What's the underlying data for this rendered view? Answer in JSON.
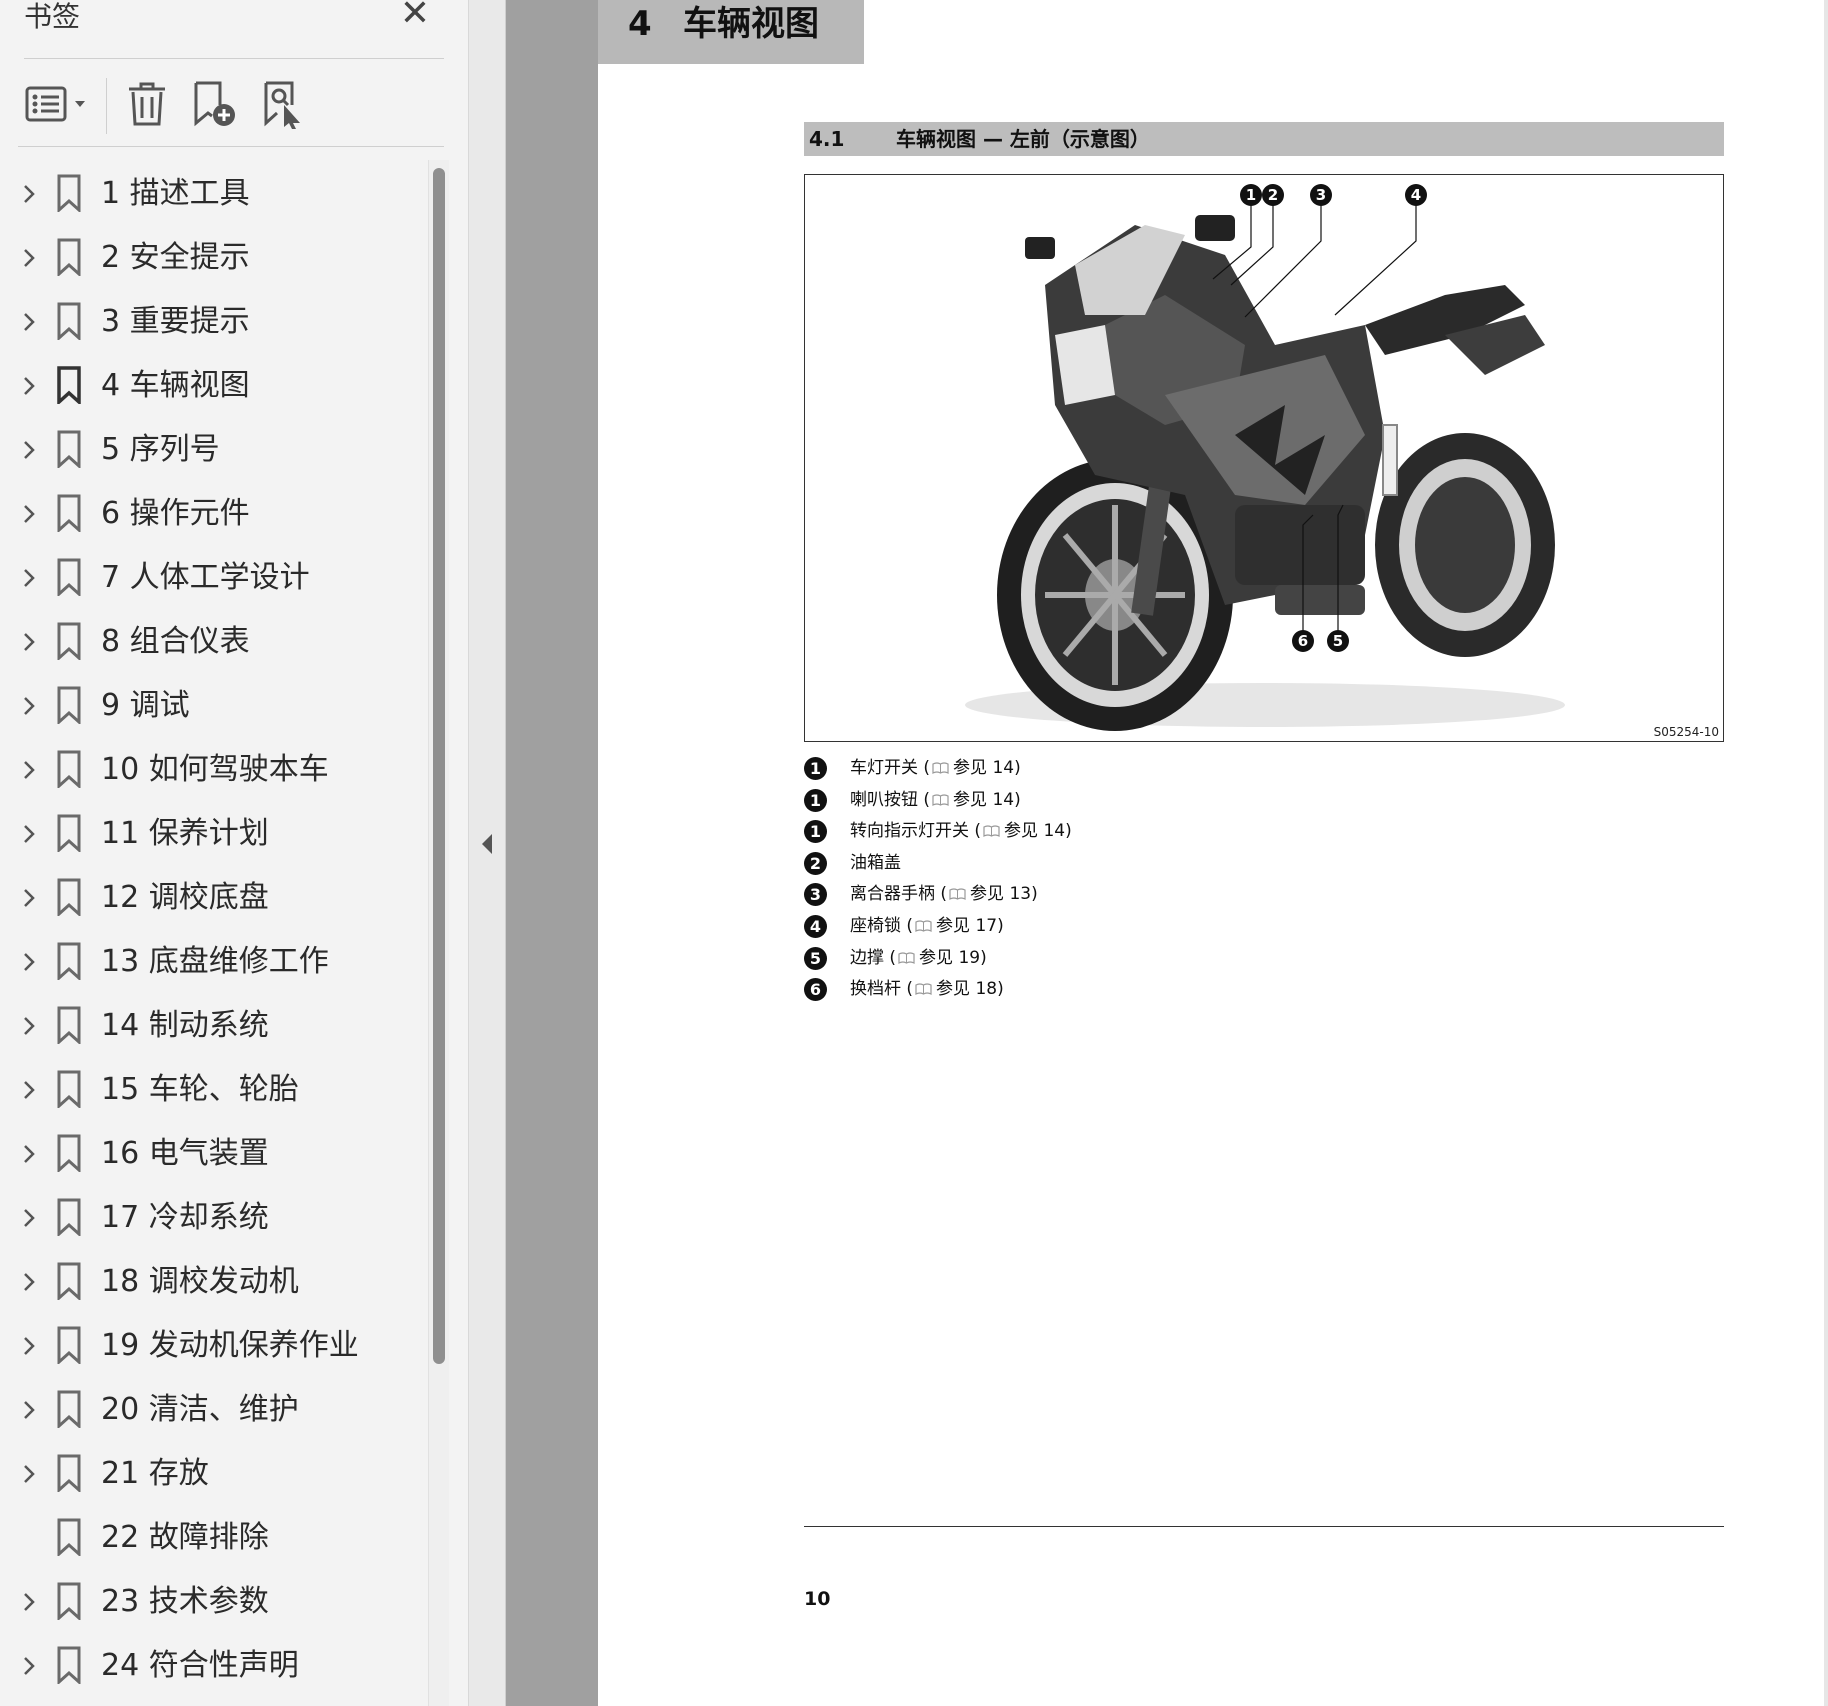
{
  "sidebar": {
    "title": "书签",
    "close_icon": "close-icon",
    "toolbar": {
      "options_icon": "list-options-icon",
      "delete_icon": "trash-icon",
      "add_icon": "add-bookmark-icon",
      "find_icon": "find-bookmark-icon"
    },
    "bookmarks": [
      {
        "label": "1 描述工具",
        "expandable": true
      },
      {
        "label": "2 安全提示",
        "expandable": true
      },
      {
        "label": "3 重要提示",
        "expandable": true
      },
      {
        "label": "4 车辆视图",
        "expandable": true,
        "current": true
      },
      {
        "label": "5 序列号",
        "expandable": true
      },
      {
        "label": "6 操作元件",
        "expandable": true
      },
      {
        "label": "7 人体工学设计",
        "expandable": true
      },
      {
        "label": "8 组合仪表",
        "expandable": true
      },
      {
        "label": "9 调试",
        "expandable": true
      },
      {
        "label": "10 如何驾驶本车",
        "expandable": true
      },
      {
        "label": "11 保养计划",
        "expandable": true
      },
      {
        "label": "12 调校底盘",
        "expandable": true
      },
      {
        "label": "13 底盘维修工作",
        "expandable": true
      },
      {
        "label": "14 制动系统",
        "expandable": true
      },
      {
        "label": "15 车轮、轮胎",
        "expandable": true
      },
      {
        "label": "16 电气装置",
        "expandable": true
      },
      {
        "label": "17 冷却系统",
        "expandable": true
      },
      {
        "label": "18 调校发动机",
        "expandable": true
      },
      {
        "label": "19 发动机保养作业",
        "expandable": true
      },
      {
        "label": "20 清洁、维护",
        "expandable": true
      },
      {
        "label": "21 存放",
        "expandable": true
      },
      {
        "label": "22 故障排除",
        "expandable": false
      },
      {
        "label": "23 技术参数",
        "expandable": true
      },
      {
        "label": "24 符合性声明",
        "expandable": true
      }
    ]
  },
  "page": {
    "chapter_number": "4",
    "chapter_title": "车辆视图",
    "section_number": "4.1",
    "section_title": "车辆视图 — 左前（示意图）",
    "figure_code": "S05254-10",
    "figure_callouts": [
      "1",
      "2",
      "3",
      "4",
      "5",
      "6"
    ],
    "legend": [
      {
        "num": "1",
        "text": "车灯开关 (",
        "ref": "参见 14)"
      },
      {
        "num": "1",
        "text": "喇叭按钮 (",
        "ref": "参见 14)"
      },
      {
        "num": "1",
        "text": "转向指示灯开关 (",
        "ref": "参见 14)"
      },
      {
        "num": "2",
        "text": "油箱盖",
        "ref": ""
      },
      {
        "num": "3",
        "text": "离合器手柄 (",
        "ref": "参见 13)"
      },
      {
        "num": "4",
        "text": "座椅锁 (",
        "ref": "参见 17)"
      },
      {
        "num": "5",
        "text": "边撑 (",
        "ref": "参见 19)"
      },
      {
        "num": "6",
        "text": "换档杆 (",
        "ref": "参见 18)"
      }
    ],
    "page_number": "10"
  }
}
